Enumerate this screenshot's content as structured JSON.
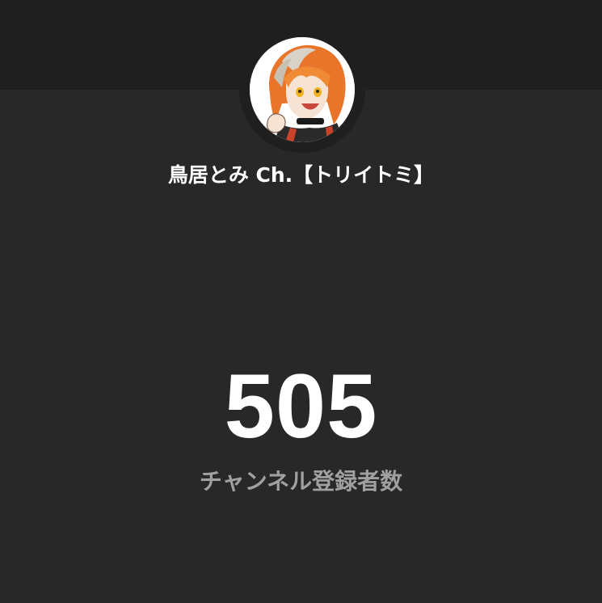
{
  "channel": {
    "name": "鳥居とみ Ch.【トリイトミ】",
    "avatar_icon": "channel-avatar-icon"
  },
  "subscribers": {
    "count": "505",
    "label": "チャンネル登録者数"
  },
  "colors": {
    "background": "#282828",
    "header_band": "#1f1f1f",
    "text_primary": "#ffffff",
    "text_secondary": "#a0a0a0"
  }
}
